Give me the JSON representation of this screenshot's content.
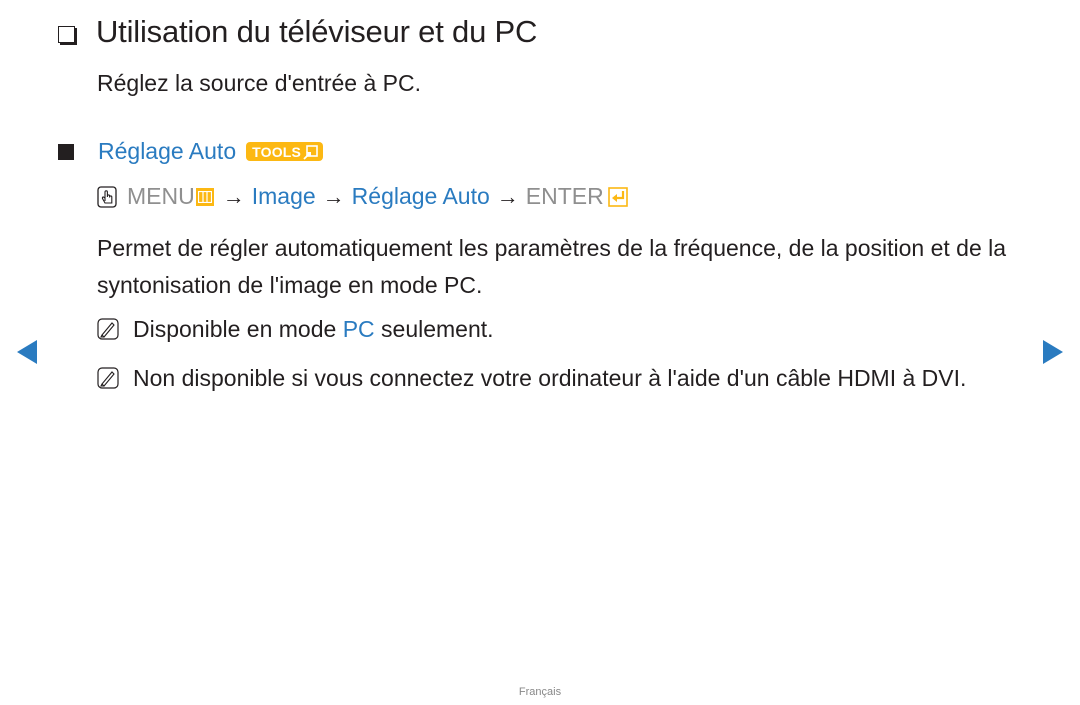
{
  "section": {
    "title": "Utilisation du téléviseur et du PC",
    "intro": "Réglez la source d'entrée à PC."
  },
  "subsection": {
    "title": "Réglage Auto",
    "tools_badge": "TOOLS",
    "menu_path": {
      "menu_label": "MENU",
      "arrow": "→",
      "step1": "Image",
      "step2": "Réglage Auto",
      "enter_label": "ENTER"
    },
    "description": "Permet de régler automatiquement les paramètres de la fréquence, de la position et de la syntonisation de l'image en mode PC.",
    "notes": [
      {
        "before": "Disponible en mode ",
        "highlight": "PC",
        "after": " seulement."
      },
      {
        "text": "Non disponible si vous connectez votre ordinateur à l'aide d'un câble HDMI à DVI."
      }
    ]
  },
  "navigation": {
    "prev_icon": "triangle-left-icon",
    "next_icon": "triangle-right-icon"
  },
  "footer": {
    "language": "Français"
  },
  "colors": {
    "accent_blue": "#2a7bc0",
    "badge_yellow": "#fcb813",
    "text": "#231f20",
    "muted": "#8f8f8f"
  }
}
